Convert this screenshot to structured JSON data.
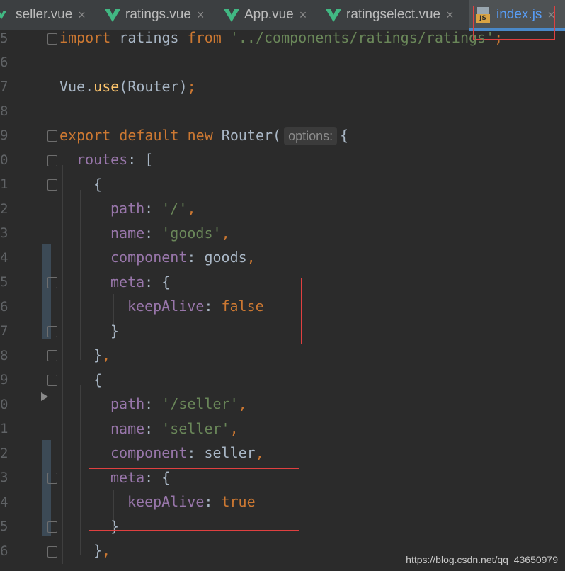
{
  "tabs": [
    {
      "label": "seller.vue",
      "icon": "vue-icon",
      "active": false
    },
    {
      "label": "ratings.vue",
      "icon": "vue-icon",
      "active": false
    },
    {
      "label": "App.vue",
      "icon": "vue-icon",
      "active": false
    },
    {
      "label": "ratingselect.vue",
      "icon": "vue-icon",
      "active": false
    },
    {
      "label": "index.js",
      "icon": "js-file-icon",
      "active": true
    }
  ],
  "close_glyph": "×",
  "js_badge": "JS",
  "line_numbers": [
    "5",
    "6",
    "7",
    "8",
    "9",
    "0",
    "1",
    "2",
    "3",
    "4",
    "5",
    "6",
    "7",
    "8",
    "9",
    "0",
    "1",
    "2",
    "3",
    "4",
    "5",
    "6"
  ],
  "code": {
    "l5": {
      "kw": "import",
      "name": " ratings ",
      "from": "from",
      "str": " '../components/ratings/ratings'",
      "semi": ";"
    },
    "l7": {
      "obj": "Vue.",
      "fn": "use",
      "rest": "(Router)",
      "semi": ";"
    },
    "l9": {
      "export": "export",
      "default": " default",
      "new": " new",
      "cls": " Router(",
      "hint": "options:",
      "brace": "{"
    },
    "l10": {
      "prop": "routes",
      "rest": ": ["
    },
    "l11": {
      "text": "{"
    },
    "l12": {
      "prop": "path",
      "colon": ": ",
      "str": "'/'",
      "comma": ","
    },
    "l13": {
      "prop": "name",
      "colon": ": ",
      "str": "'goods'",
      "comma": ","
    },
    "l14": {
      "prop": "component",
      "rest": ": goods",
      "comma": ","
    },
    "l15": {
      "prop": "meta",
      "rest": ": {"
    },
    "l16": {
      "prop": "keepAlive",
      "colon": ": ",
      "kw": "false"
    },
    "l17": {
      "text": "}"
    },
    "l18": {
      "text": "}",
      "comma": ","
    },
    "l19": {
      "text": "{"
    },
    "l20": {
      "prop": "path",
      "colon": ": ",
      "str": "'/seller'",
      "comma": ","
    },
    "l21": {
      "prop": "name",
      "colon": ": ",
      "str": "'seller'",
      "comma": ","
    },
    "l22": {
      "prop": "component",
      "rest": ": seller",
      "comma": ","
    },
    "l23": {
      "prop": "meta",
      "rest": ": {"
    },
    "l24": {
      "prop": "keepAlive",
      "colon": ": ",
      "kw": "true"
    },
    "l25": {
      "text": "}"
    },
    "l26": {
      "text": "}",
      "comma": ","
    }
  },
  "watermark": "https://blog.csdn.net/qq_43650979",
  "colors": {
    "keyword": "#cc7832",
    "string": "#6a8759",
    "property": "#9876aa",
    "function": "#ffc66d",
    "text": "#a9b7c6",
    "highlight_box": "#e04040",
    "background": "#2b2b2b"
  }
}
